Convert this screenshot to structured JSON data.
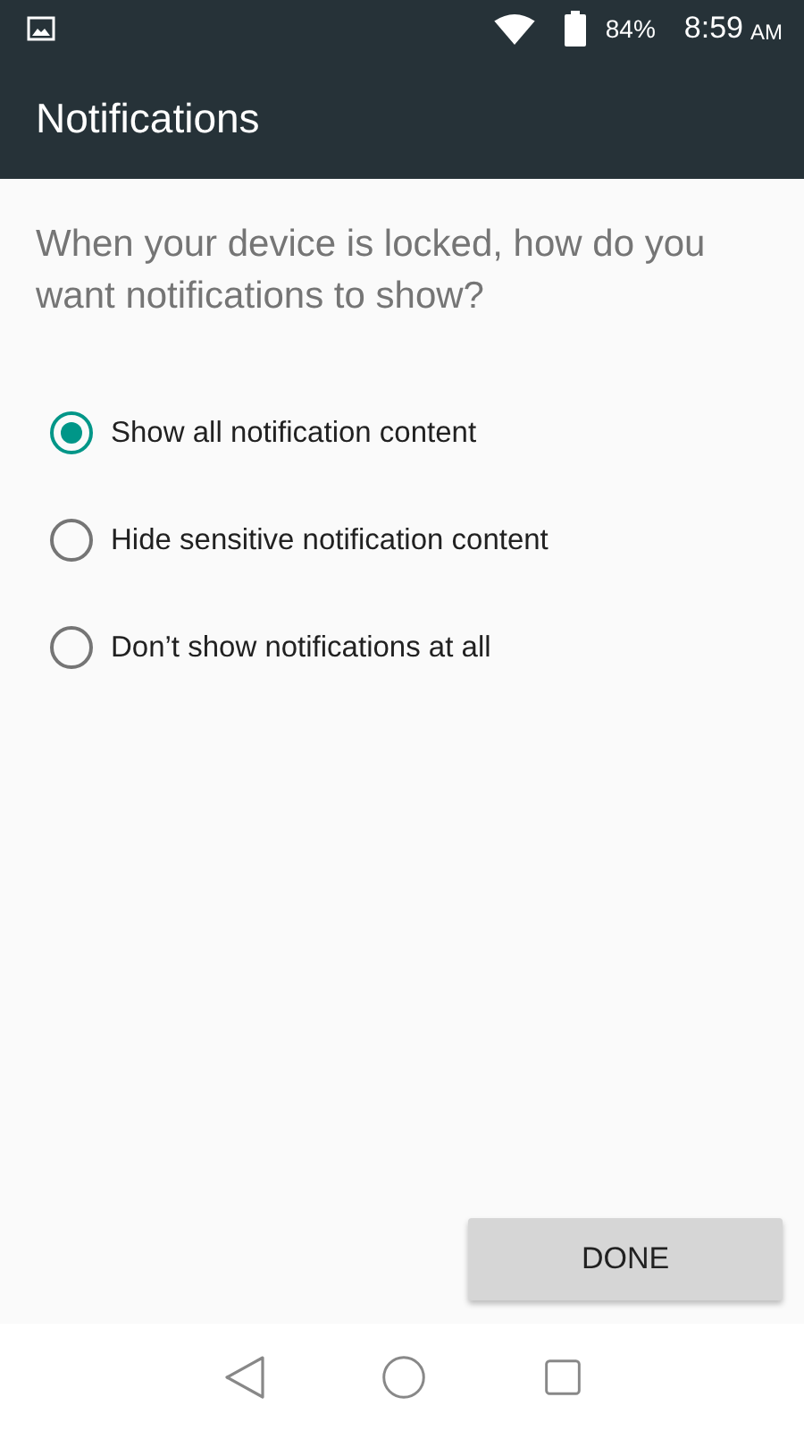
{
  "status_bar": {
    "battery": "84%",
    "time": "8:59",
    "meridiem": "AM"
  },
  "toolbar": {
    "title": "Notifications"
  },
  "question": "When your device is locked, how do you want notifications to show?",
  "options": [
    {
      "label": "Show all notification content",
      "selected": true
    },
    {
      "label": "Hide sensitive notification content",
      "selected": false
    },
    {
      "label": "Don’t show notifications at all",
      "selected": false
    }
  ],
  "done_button": "DONE"
}
